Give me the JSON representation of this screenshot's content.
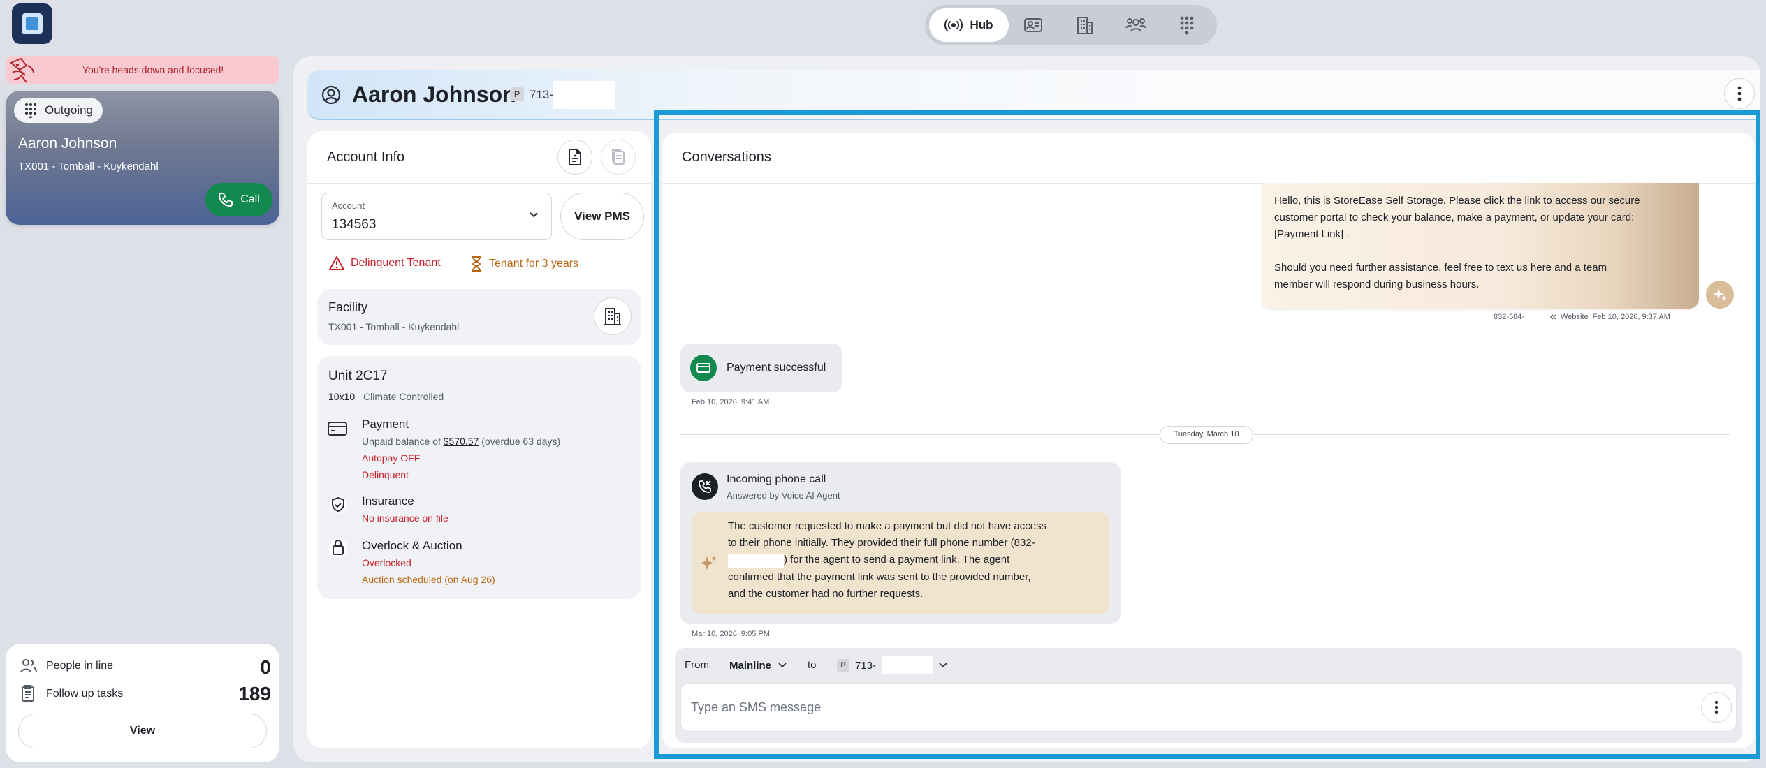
{
  "colors": {
    "app_bg": "#dde0e6",
    "accent_blue": "#1a9ad6",
    "call_green": "#12894e",
    "danger_red": "#c8232c",
    "warning_orange": "#b96612",
    "focus_banner": "#f8c9cf",
    "caller_card_gradient": [
      "#8f94a3",
      "#4c6396"
    ]
  },
  "app": {
    "logo": "app-logo-icon"
  },
  "top_nav": {
    "items": [
      {
        "icon": "broadcast-icon",
        "label": "Hub",
        "active": true
      },
      {
        "icon": "contact-card-icon",
        "label": ""
      },
      {
        "icon": "building-icon",
        "label": ""
      },
      {
        "icon": "people-icon",
        "label": ""
      },
      {
        "icon": "dialpad-icon",
        "label": ""
      }
    ]
  },
  "focus_banner": {
    "text": "You're heads down and focused!"
  },
  "call_card": {
    "status": "Outgoing",
    "name": "Aaron Johnson",
    "location": "TX001 - Tomball - Kuykendahl",
    "call_button": "Call"
  },
  "queue": {
    "people_in_line_label": "People in line",
    "people_in_line_count": "0",
    "follow_up_label": "Follow up tasks",
    "follow_up_count": "189",
    "view_button": "View"
  },
  "contact_header": {
    "name": "Aaron Johnson",
    "phone_badge": "P",
    "phone": "713-"
  },
  "account_info": {
    "title": "Account Info",
    "account_label": "Account",
    "account_value": "134563",
    "view_pms": "View PMS",
    "delinquent_tag": "Delinquent Tenant",
    "tenure_tag": "Tenant for 3 years",
    "facility_label": "Facility",
    "facility_value": "TX001 - Tomball - Kuykendahl",
    "unit": {
      "title": "Unit 2C17",
      "size": "10x10",
      "climate": "Climate Controlled",
      "payment_title": "Payment",
      "payment_prefix": "Unpaid balance of",
      "payment_amount": "$570.57",
      "payment_overdue": "(overdue 63 days)",
      "autopay": "Autopay OFF",
      "delinquent": "Delinquent",
      "insurance_title": "Insurance",
      "insurance_status": "No insurance on file",
      "overlock_title": "Overlock & Auction",
      "overlock_status": "Overlocked",
      "auction_status": "Auction scheduled (on Aug 26)"
    }
  },
  "conversations": {
    "title": "Conversations",
    "outgoing_sms": {
      "line1": "Hello, this is StoreEase Self Storage. Please click the link to access our secure",
      "line2": "customer portal to check your balance, make a payment, or update your card:",
      "line3": "[Payment Link] .",
      "line4": "Should you need further assistance, feel free to text us here and a team",
      "line5": "member will respond during business hours.",
      "meta_number": "832-584-",
      "meta_source": "Website",
      "meta_time": "Feb 10, 2026, 9:37 AM"
    },
    "payment_event": {
      "text": "Payment successful",
      "time": "Feb 10, 2026, 9:41 AM"
    },
    "date_divider": "Tuesday, March 10",
    "call_event": {
      "title": "Incoming phone call",
      "subtitle": "Answered by Voice AI Agent",
      "summary_line1": "The customer requested to make a payment but did not have access",
      "summary_line2": "to their phone initially. They provided their full phone number (832-",
      "summary_line3": ") for the agent to send a payment link. The agent",
      "summary_line4": "confirmed that the payment link was sent to the provided number,",
      "summary_line5": "and the customer had no further requests.",
      "time": "Mar 10, 2026, 9:05 PM"
    },
    "composer": {
      "from_label": "From",
      "from_value": "Mainline",
      "to_label": "to",
      "to_badge": "P",
      "to_value": "713-",
      "placeholder": "Type an SMS message"
    }
  }
}
